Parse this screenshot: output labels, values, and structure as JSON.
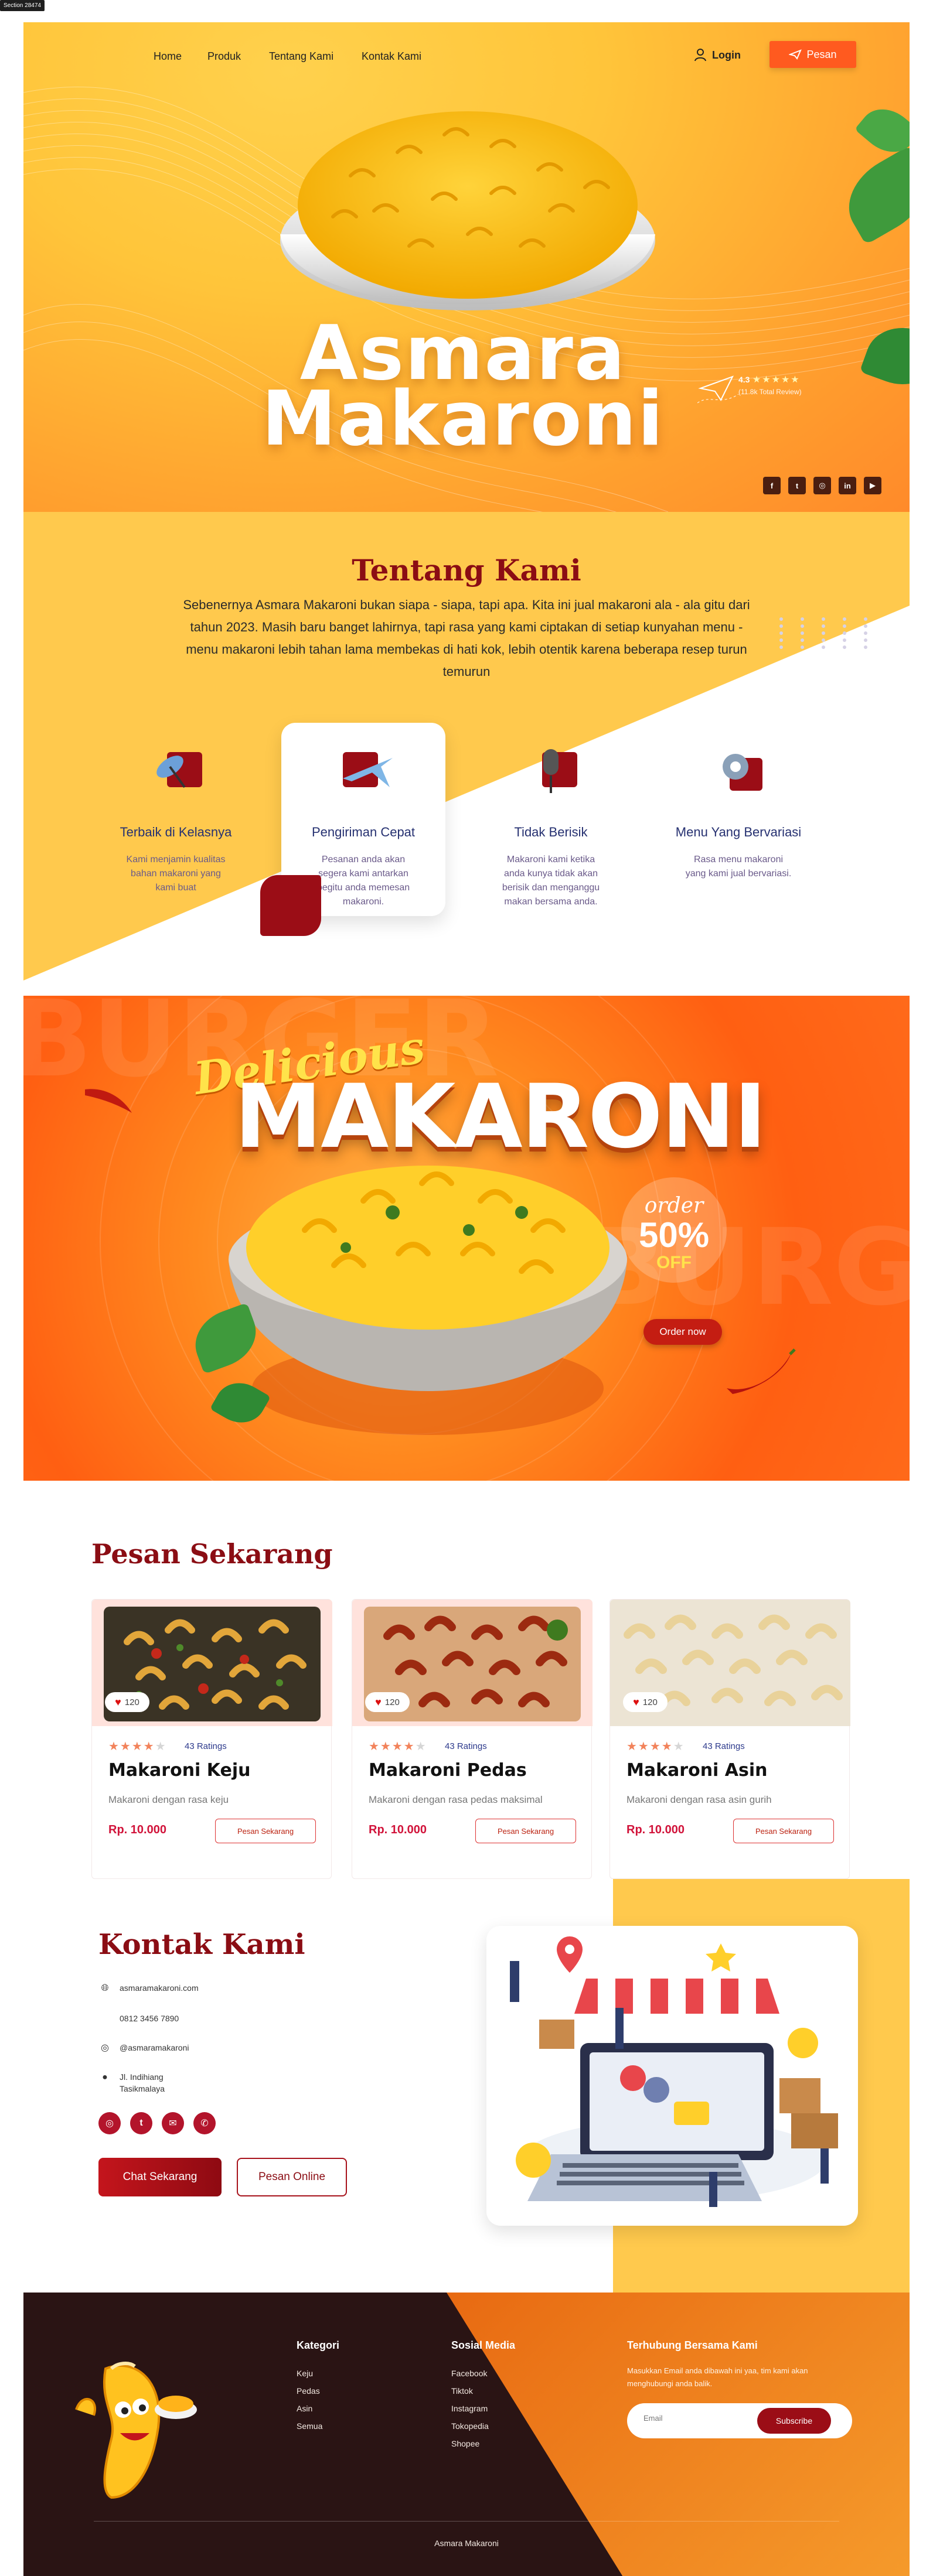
{
  "section_tag": "Section 28474",
  "nav": {
    "links": [
      "Home",
      "Produk",
      "Tentang Kami",
      "Kontak Kami"
    ],
    "login_label": "Login",
    "order_label": "Pesan"
  },
  "hero": {
    "title_line1": "Asmara",
    "title_line2": "Makaroni",
    "rating_value": "4.3",
    "stars": "★★★★★",
    "review_text": "(11.8k Total Review)",
    "socials": [
      "facebook-icon",
      "twitter-icon",
      "instagram-icon",
      "linkedin-icon",
      "youtube-icon"
    ]
  },
  "about": {
    "title": "Tentang Kami",
    "text": "Sebenernya Asmara Makaroni bukan siapa - siapa, tapi apa. Kita ini jual makaroni ala - ala gitu dari tahun 2023. Masih baru banget lahirnya, tapi rasa yang kami ciptakan di setiap kunyahan menu - menu makaroni lebih tahan lama membekas di hati kok, lebih otentik karena beberapa resep turun temurun",
    "features": [
      {
        "title": "Terbaik di Kelasnya",
        "desc": "Kami menjamin kualitas bahan makaroni yang kami buat",
        "icon": "satellite-dish-icon"
      },
      {
        "title": "Pengiriman Cepat",
        "desc": "Pesanan anda akan segera kami antarkan begitu anda memesan makaroni.",
        "icon": "airplane-icon"
      },
      {
        "title": "Tidak Berisik",
        "desc": "Makaroni kami ketika anda kunya tidak akan berisik dan menganggu makan bersama anda.",
        "icon": "microphone-icon"
      },
      {
        "title": "Menu Yang Bervariasi",
        "desc": "Rasa menu makaroni yang kami jual bervariasi.",
        "icon": "gear-icon"
      }
    ]
  },
  "banner": {
    "script_word": "Delicious",
    "big_word": "MAKARONI",
    "order_word": "order",
    "percent": "50%",
    "off_word": "OFF",
    "cta": "Order now"
  },
  "products": {
    "title": "Pesan Sekarang",
    "items": [
      {
        "name": "Makaroni Keju",
        "likes": "120",
        "ratings": "43 Ratings",
        "desc": "Makaroni dengan rasa keju",
        "price": "Rp. 10.000",
        "button": "Pesan Sekarang",
        "stars_on": 4
      },
      {
        "name": "Makaroni Pedas",
        "likes": "120",
        "ratings": "43 Ratings",
        "desc": "Makaroni dengan rasa pedas maksimal",
        "price": "Rp. 10.000",
        "button": "Pesan Sekarang",
        "stars_on": 4
      },
      {
        "name": "Makaroni Asin",
        "likes": "120",
        "ratings": "43 Ratings",
        "desc": "Makaroni dengan rasa asin gurih",
        "price": "Rp. 10.000",
        "button": "Pesan Sekarang",
        "stars_on": 4
      }
    ]
  },
  "contact": {
    "title": "Kontak Kami",
    "email": "asmaramakaroni.com",
    "phone": "0812 3456 7890",
    "instagram": "@asmaramakaroni",
    "address_line1": "Jl. Indihiang",
    "address_line2": "Tasikmalaya",
    "chat_label": "Chat Sekarang",
    "online_label": "Pesan Online"
  },
  "footer": {
    "col1_title": "Kategori",
    "col1_items": [
      "Keju",
      "Pedas",
      "Asin",
      "Semua"
    ],
    "col2_title": "Sosial Media",
    "col2_items": [
      "Facebook",
      "Tiktok",
      "Instagram",
      "Tokopedia",
      "Shopee"
    ],
    "col3_title": "Terhubung Bersama Kami",
    "col3_text": "Masukkan Email anda dibawah ini yaa, tim kami akan menghubungi anda balik.",
    "email_placeholder": "Email",
    "subscribe_label": "Subscribe",
    "copyright": "Asmara Makaroni"
  },
  "colors": {
    "brand_red": "#8b0d14",
    "accent_orange": "#ff5a1f",
    "yellow": "#ffc94d",
    "price_pink": "#d1133a"
  }
}
